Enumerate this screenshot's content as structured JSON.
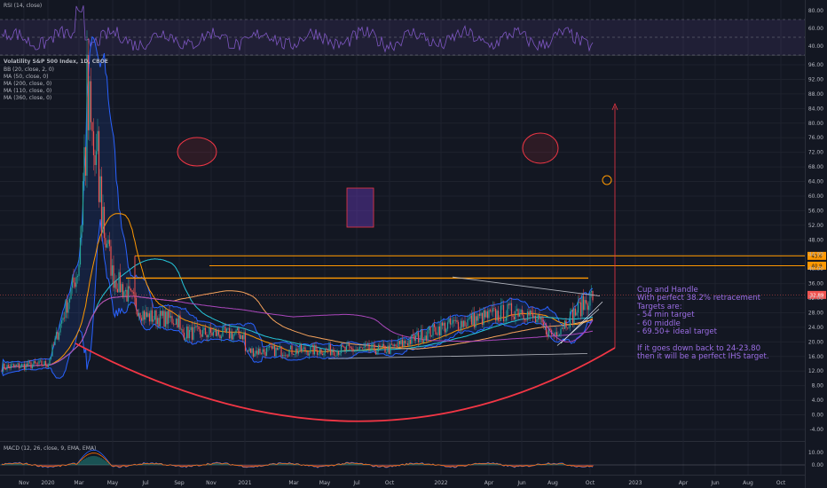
{
  "rsi": {
    "title": "RSI (14, close)",
    "ticks": [
      "80.00",
      "60.00",
      "40.00"
    ]
  },
  "main": {
    "title": "Volatility S&P 500 Index, 1D, CBOE",
    "indicators": [
      "BB (20, close, 2, 0)",
      "MA (50, close, 0)",
      "MA (200, close, 0)",
      "MA (110, close, 0)",
      "MA (360, close, 0)"
    ],
    "price_label": "32.89",
    "level_labels": [
      "43.6",
      "40.9"
    ],
    "annotation": [
      "Cup and Handle",
      "With perfect 38.2% retracement",
      "Targets are:",
      "- 54 min target",
      "- 60 middle",
      "- 69.50+ ideal target",
      "",
      "If it goes down back to 24-23.80",
      "then it will be a perfect IHS target."
    ]
  },
  "macd": {
    "title": "MACD (12, 26, close, 9, EMA, EMA)",
    "ticks": [
      "10.00",
      "0.00"
    ]
  },
  "colors": {
    "background": "#131722",
    "candle_up": "#26a69a",
    "candle_down": "#ef5350",
    "bb": "#2962ff",
    "annotation": "#9c6ee6",
    "orange": "#ff9800",
    "red_curve": "#f23645"
  },
  "chart_data": {
    "type": "candlestick",
    "symbol": "VIX",
    "y_axis_ticks": [
      96,
      92,
      88,
      84,
      80,
      76,
      72,
      68,
      64,
      60,
      56,
      52,
      48,
      44,
      40,
      36,
      32,
      28,
      24,
      20,
      16,
      12,
      8,
      4,
      0,
      -4
    ],
    "x_axis_ticks": [
      "Nov",
      "2020",
      "Mar",
      "May",
      "Jul",
      "Sep",
      "Nov",
      "2021",
      "Mar",
      "May",
      "Jul",
      "Oct",
      "2022",
      "Apr",
      "Jun",
      "Aug",
      "Oct",
      "2023",
      "Apr",
      "Jun",
      "Aug",
      "Oct"
    ],
    "close_path": [
      [
        "Nov",
        13
      ],
      [
        "2020",
        14
      ],
      [
        "Mar",
        40
      ],
      [
        "Mar",
        82
      ],
      [
        "May",
        38
      ],
      [
        "Jul",
        27
      ],
      [
        "Sep",
        26
      ],
      [
        "Nov",
        24
      ],
      [
        "2021",
        22
      ],
      [
        "Mar",
        22
      ],
      [
        "May",
        20
      ],
      [
        "Jul",
        17
      ],
      [
        "Oct",
        18
      ],
      [
        "2022",
        24
      ],
      [
        "Apr",
        27
      ],
      [
        "Jun",
        29
      ],
      [
        "Aug",
        22
      ],
      [
        "Oct",
        32.89
      ]
    ],
    "last_price": 32.89,
    "resistance_levels": [
      43.6,
      40.9,
      37.5
    ],
    "targets": [
      54,
      60,
      69.5
    ],
    "retracement": "38.2%"
  }
}
